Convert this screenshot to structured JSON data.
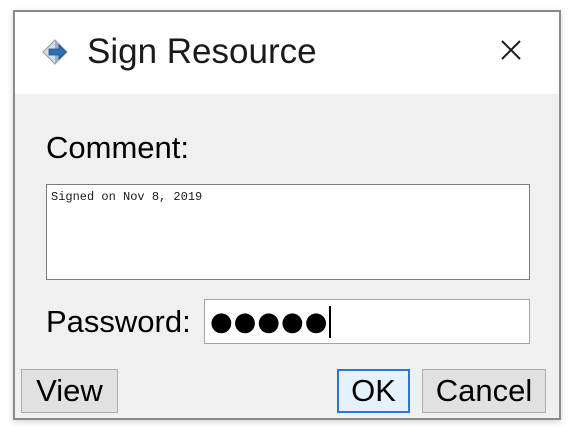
{
  "dialog": {
    "title": "Sign Resource",
    "icon": "app-diamond-icon",
    "close_icon": "close-icon"
  },
  "comment": {
    "label": "Comment:",
    "value": "Signed on Nov 8, 2019"
  },
  "password": {
    "label": "Password:",
    "masked_value": "●●●●●"
  },
  "buttons": {
    "view": "View",
    "ok": "OK",
    "cancel": "Cancel"
  },
  "colors": {
    "focus_accent": "#2a78d6",
    "dialog_background": "#f0f0f0",
    "titlebar_background": "#ffffff"
  }
}
